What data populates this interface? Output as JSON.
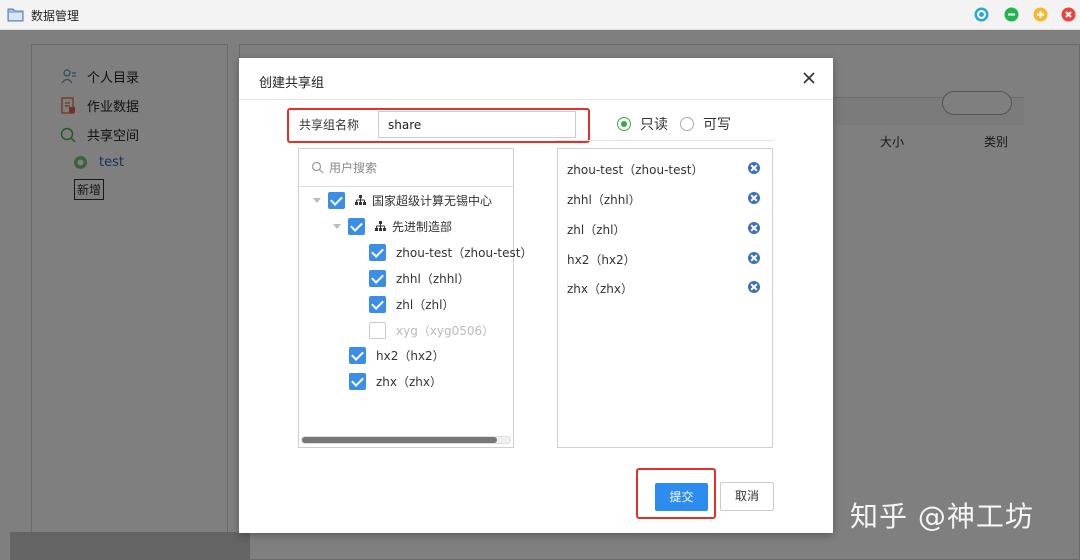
{
  "window": {
    "title": "数据管理",
    "controls": [
      "refresh-icon",
      "minimize-icon",
      "maximize-icon",
      "close-icon"
    ]
  },
  "sidebar": {
    "items": [
      {
        "label": "个人目录",
        "icon": "user-folder-icon"
      },
      {
        "label": "作业数据",
        "icon": "job-data-icon"
      },
      {
        "label": "共享空间",
        "icon": "shared-space-icon"
      },
      {
        "label": "test",
        "icon": "group-icon"
      }
    ],
    "new_button": "新增"
  },
  "file_list": {
    "columns": [
      "大小",
      "类别"
    ]
  },
  "modal": {
    "title": "创建共享组",
    "name_label": "共享组名称",
    "name_value": "share",
    "permissions": [
      {
        "label": "只读",
        "checked": true
      },
      {
        "label": "可写",
        "checked": false
      }
    ],
    "user_search_placeholder": "用户搜索",
    "tree": {
      "root": {
        "label": "国家超级计算无锡中心",
        "checked": true
      },
      "dept": {
        "label": "先进制造部",
        "checked": true
      },
      "dept_users": [
        {
          "label": "zhou-test（zhou-test）",
          "checked": true
        },
        {
          "label": "zhhl（zhhl）",
          "checked": true
        },
        {
          "label": "zhl（zhl）",
          "checked": true
        },
        {
          "label": "xyg（xyg0506）",
          "checked": false
        }
      ],
      "root_users": [
        {
          "label": "hx2（hx2）",
          "checked": true
        },
        {
          "label": "zhx（zhx）",
          "checked": true
        }
      ]
    },
    "selected": [
      "zhou-test（zhou-test）",
      "zhhl（zhhl）",
      "zhl（zhl）",
      "hx2（hx2）",
      "zhx（zhx）"
    ],
    "submit_label": "提交",
    "cancel_label": "取消"
  },
  "watermark": "知乎 @神工坊",
  "colors": {
    "accent": "#2d8cf0",
    "highlight_border": "#e0322b",
    "radio_checked": "#3aa845"
  }
}
